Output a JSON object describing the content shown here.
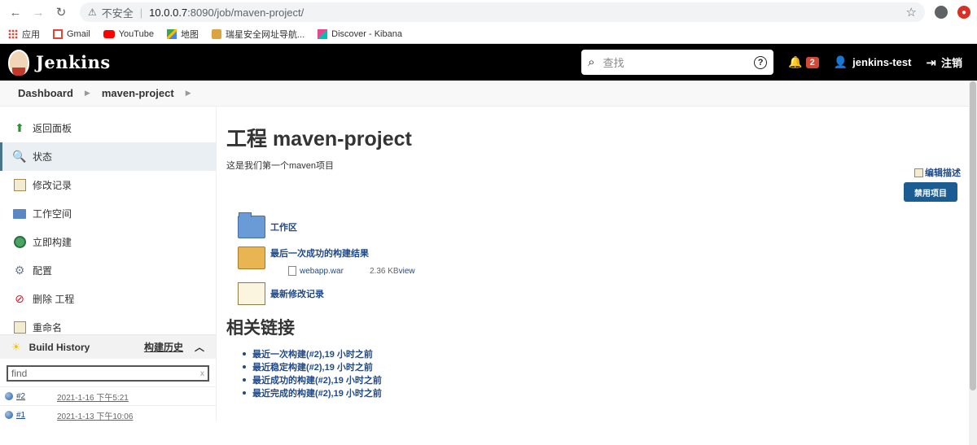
{
  "browser": {
    "insecure_label": "不安全",
    "host": "10.0.0.7",
    "path": ":8090/job/maven-project/",
    "bookmarks": [
      "应用",
      "Gmail",
      "YouTube",
      "地图",
      "瑞星安全网址导航...",
      "Discover - Kibana"
    ]
  },
  "header": {
    "brand": "Jenkins",
    "search_placeholder": "查找",
    "notification_count": "2",
    "user": "jenkins-test",
    "logout": "注销"
  },
  "breadcrumb": [
    "Dashboard",
    "maven-project"
  ],
  "sidebar": {
    "items": [
      {
        "label": "返回面板",
        "icon": "arrow-up-icon"
      },
      {
        "label": "状态",
        "icon": "search-icon"
      },
      {
        "label": "修改记录",
        "icon": "notepad-icon"
      },
      {
        "label": "工作空间",
        "icon": "folder-icon"
      },
      {
        "label": "立即构建",
        "icon": "build-icon"
      },
      {
        "label": "配置",
        "icon": "gear-icon"
      },
      {
        "label": "删除 工程",
        "icon": "delete-icon"
      },
      {
        "label": "重命名",
        "icon": "rename-icon"
      }
    ],
    "history": {
      "title": "Build History",
      "link": "构建历史",
      "find_placeholder": "find",
      "clear": "x",
      "builds": [
        {
          "num": "#2",
          "date": "2021-1-16 下午5:21"
        },
        {
          "num": "#1",
          "date": "2021-1-13 下午10:06"
        }
      ]
    }
  },
  "main": {
    "title": "工程 maven-project",
    "description": "这是我们第一个maven项目",
    "edit_description": "编辑描述",
    "disable_button": "禁用项目",
    "workspace": "工作区",
    "last_success": "最后一次成功的构建结果",
    "artifact": {
      "name": "webapp.war",
      "size": "2.36 KB",
      "view": "view"
    },
    "recent_changes": "最新修改记录",
    "related_title": "相关链接",
    "links": [
      "最近一次构建(#2),19 小时之前",
      "最近稳定构建(#2),19 小时之前",
      "最近成功的构建(#2),19 小时之前",
      "最近完成的构建(#2),19 小时之前"
    ]
  }
}
